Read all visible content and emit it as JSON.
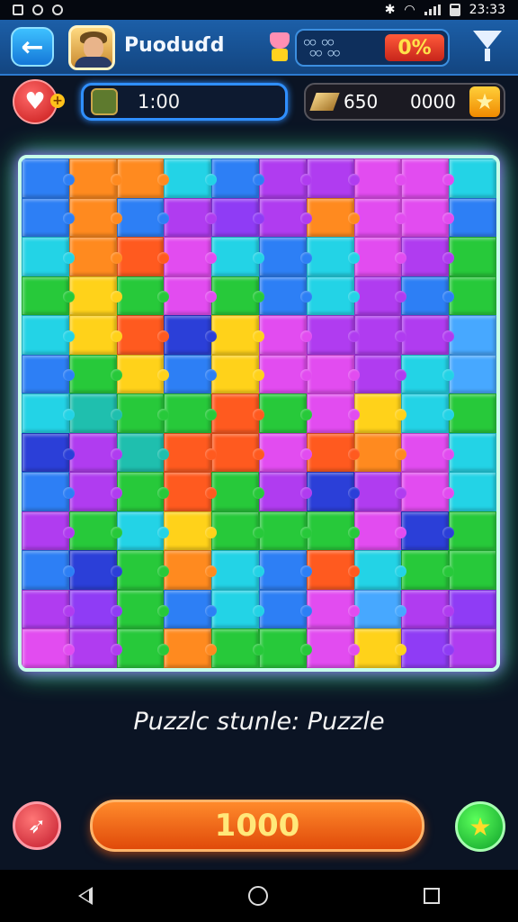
{
  "status_bar": {
    "time": "23:33"
  },
  "header": {
    "back_icon": "arrow-left-icon",
    "title": "Puoduɗd",
    "progress_dots": "○○ ○○\n ○○ ○○",
    "progress_percent": "0%",
    "filter_icon": "funnel-icon"
  },
  "stats": {
    "lives_icon": "heart-icon",
    "timer": "1:00",
    "coins_a": "650",
    "coins_b": "0000",
    "star_icon": "star-icon"
  },
  "board": {
    "columns": 10,
    "rows": 13,
    "colors": {
      "O": "#ff8a1f",
      "G": "#27c93a",
      "C": "#23d3e6",
      "B": "#2d7ff5",
      "P": "#b03cf0",
      "M": "#e24cf0",
      "Y": "#ffd21a",
      "R": "#ff5a1f",
      "T": "#1fbfae",
      "N": "#2b3fd8",
      "L": "#47a8ff",
      "V": "#8f3cf5"
    },
    "pieces": [
      "BOOCBPPMMC",
      "BOBPVPOMMB",
      "CORMCBCMPG",
      "GYGMGBCPBG",
      "CYRNYMPPPL",
      "BGYBYMMPCL",
      "CTGGRGMYCG",
      "NPTRRMROMC",
      "BPGRGPNPMC",
      "PGCYGGGMNG",
      "BNGOCBRCGG",
      "PVGBCBMLPV",
      "MPGOGGMYVP"
    ]
  },
  "caption": "Puzzlc stunle: Puzzle",
  "actions": {
    "rocket_icon": "rocket-icon",
    "main_value": "1000",
    "star_icon": "star-icon"
  }
}
